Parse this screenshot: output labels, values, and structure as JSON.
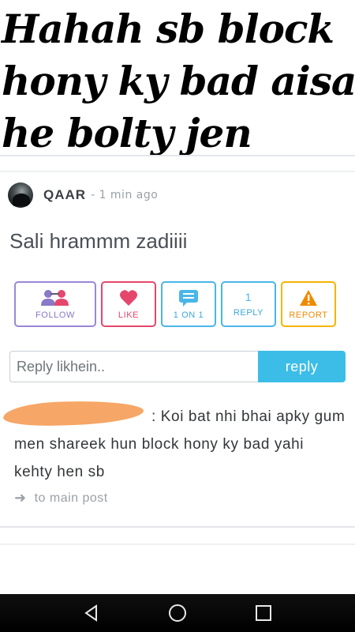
{
  "caption": {
    "lines": [
      "Hahah sb block",
      "hony ky bad aisa",
      "he bolty jen"
    ]
  },
  "post": {
    "author": "QAAR",
    "time": "- 1 min ago",
    "body": "Sali hrammm zadiiii"
  },
  "actions": {
    "follow": {
      "label": "FOLLOW",
      "icon": "people-icon"
    },
    "like": {
      "label": "LIKE",
      "icon": "heart-icon"
    },
    "one_on_one": {
      "label": "1 ON 1",
      "icon": "chat-icon"
    },
    "reply": {
      "label": "REPLY",
      "count": "1"
    },
    "report": {
      "label": "REPORT",
      "icon": "warning-icon"
    }
  },
  "reply_form": {
    "placeholder": "Reply likhein..",
    "button_label": "reply"
  },
  "reply": {
    "text": ": Koi bat nhi bhai apky gum men shareek hun block hony ky bad yahi kehty hen sb",
    "to_main_label": "to main post"
  },
  "colors": {
    "follow": "#9b87d6",
    "like": "#e5476c",
    "info": "#49b6e8",
    "report": "#f5b400",
    "reply_button": "#3cbde8",
    "redaction": "#f5a15e"
  }
}
